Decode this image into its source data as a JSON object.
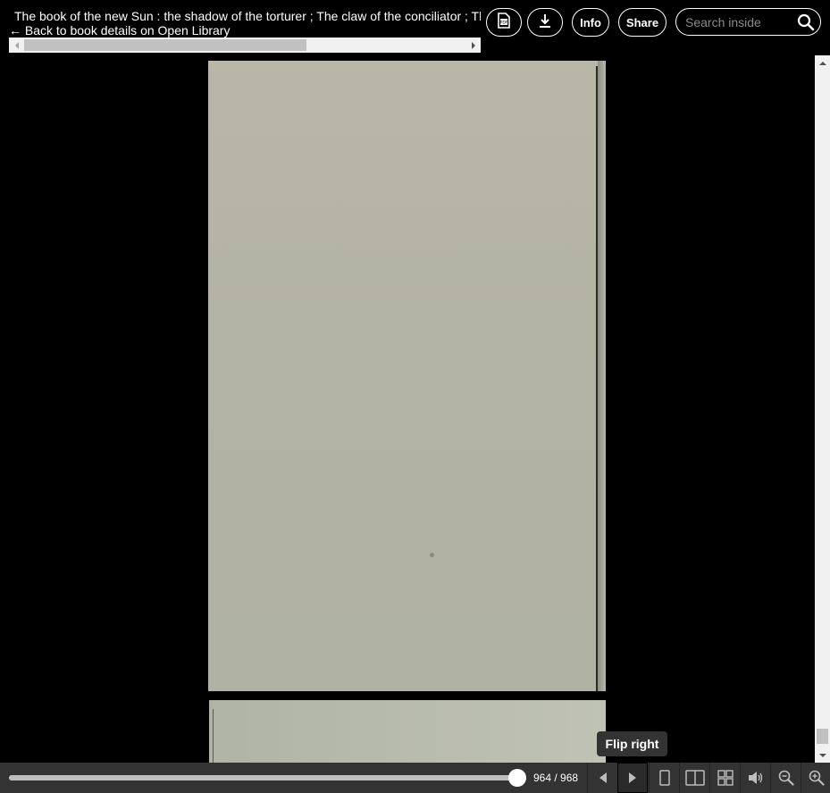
{
  "header": {
    "book_title": "The book of the new Sun : the shadow of the torturer ; The claw of the conciliator ; The sword of the lictor ; The citadel of the autarch",
    "back_link": "← Back to book details on Open Library",
    "info_label": "Info",
    "share_label": "Share",
    "search_placeholder": "Search inside",
    "icons": {
      "pdf": "pdf-file-icon",
      "download": "download-icon",
      "search": "search-icon"
    }
  },
  "tooltip": {
    "text": "Flip right"
  },
  "navbar": {
    "page_display": "964 / 968",
    "current_page": 964,
    "total_pages": 968,
    "icons": {
      "flip_left": "flip-left-icon",
      "flip_right": "flip-right-icon",
      "one_page": "one-page-view-icon",
      "two_page": "two-page-view-icon",
      "thumbnails": "thumbnail-view-icon",
      "read_aloud": "speaker-icon",
      "zoom_out": "zoom-out-icon",
      "zoom_in": "zoom-in-icon"
    }
  },
  "colors": {
    "background": "#000000",
    "navbar": "#333333",
    "page_paper": "#b3b3a4",
    "tooltip": "#333333"
  }
}
